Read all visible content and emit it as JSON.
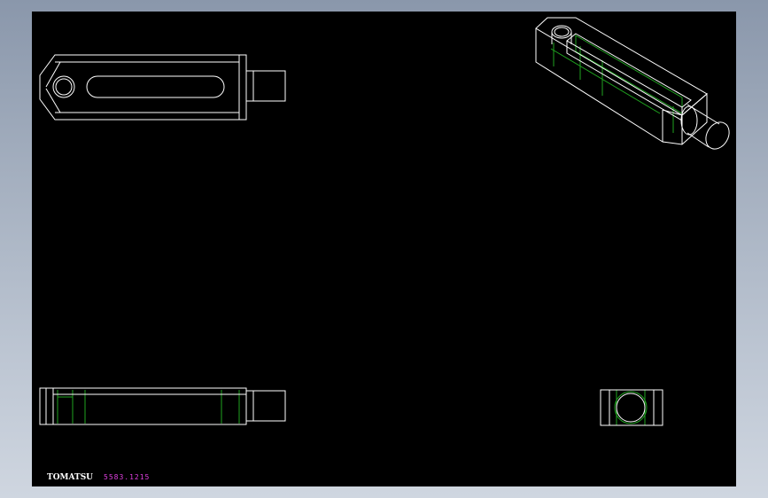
{
  "colors": {
    "background_top": "#8a97ab",
    "background_bottom": "#cfd6e0",
    "sheet": "#000000",
    "outline": "#ffffff",
    "hidden_lines": "#1fa31f",
    "brand_text": "#ffffff",
    "part_number_text": "#e040e0"
  },
  "title_block": {
    "brand": "TOMATSU",
    "part_number": "5583.1215"
  },
  "views": [
    {
      "id": "top-view",
      "label": ""
    },
    {
      "id": "isometric-view",
      "label": ""
    },
    {
      "id": "front-view",
      "label": ""
    },
    {
      "id": "side-view",
      "label": ""
    }
  ]
}
